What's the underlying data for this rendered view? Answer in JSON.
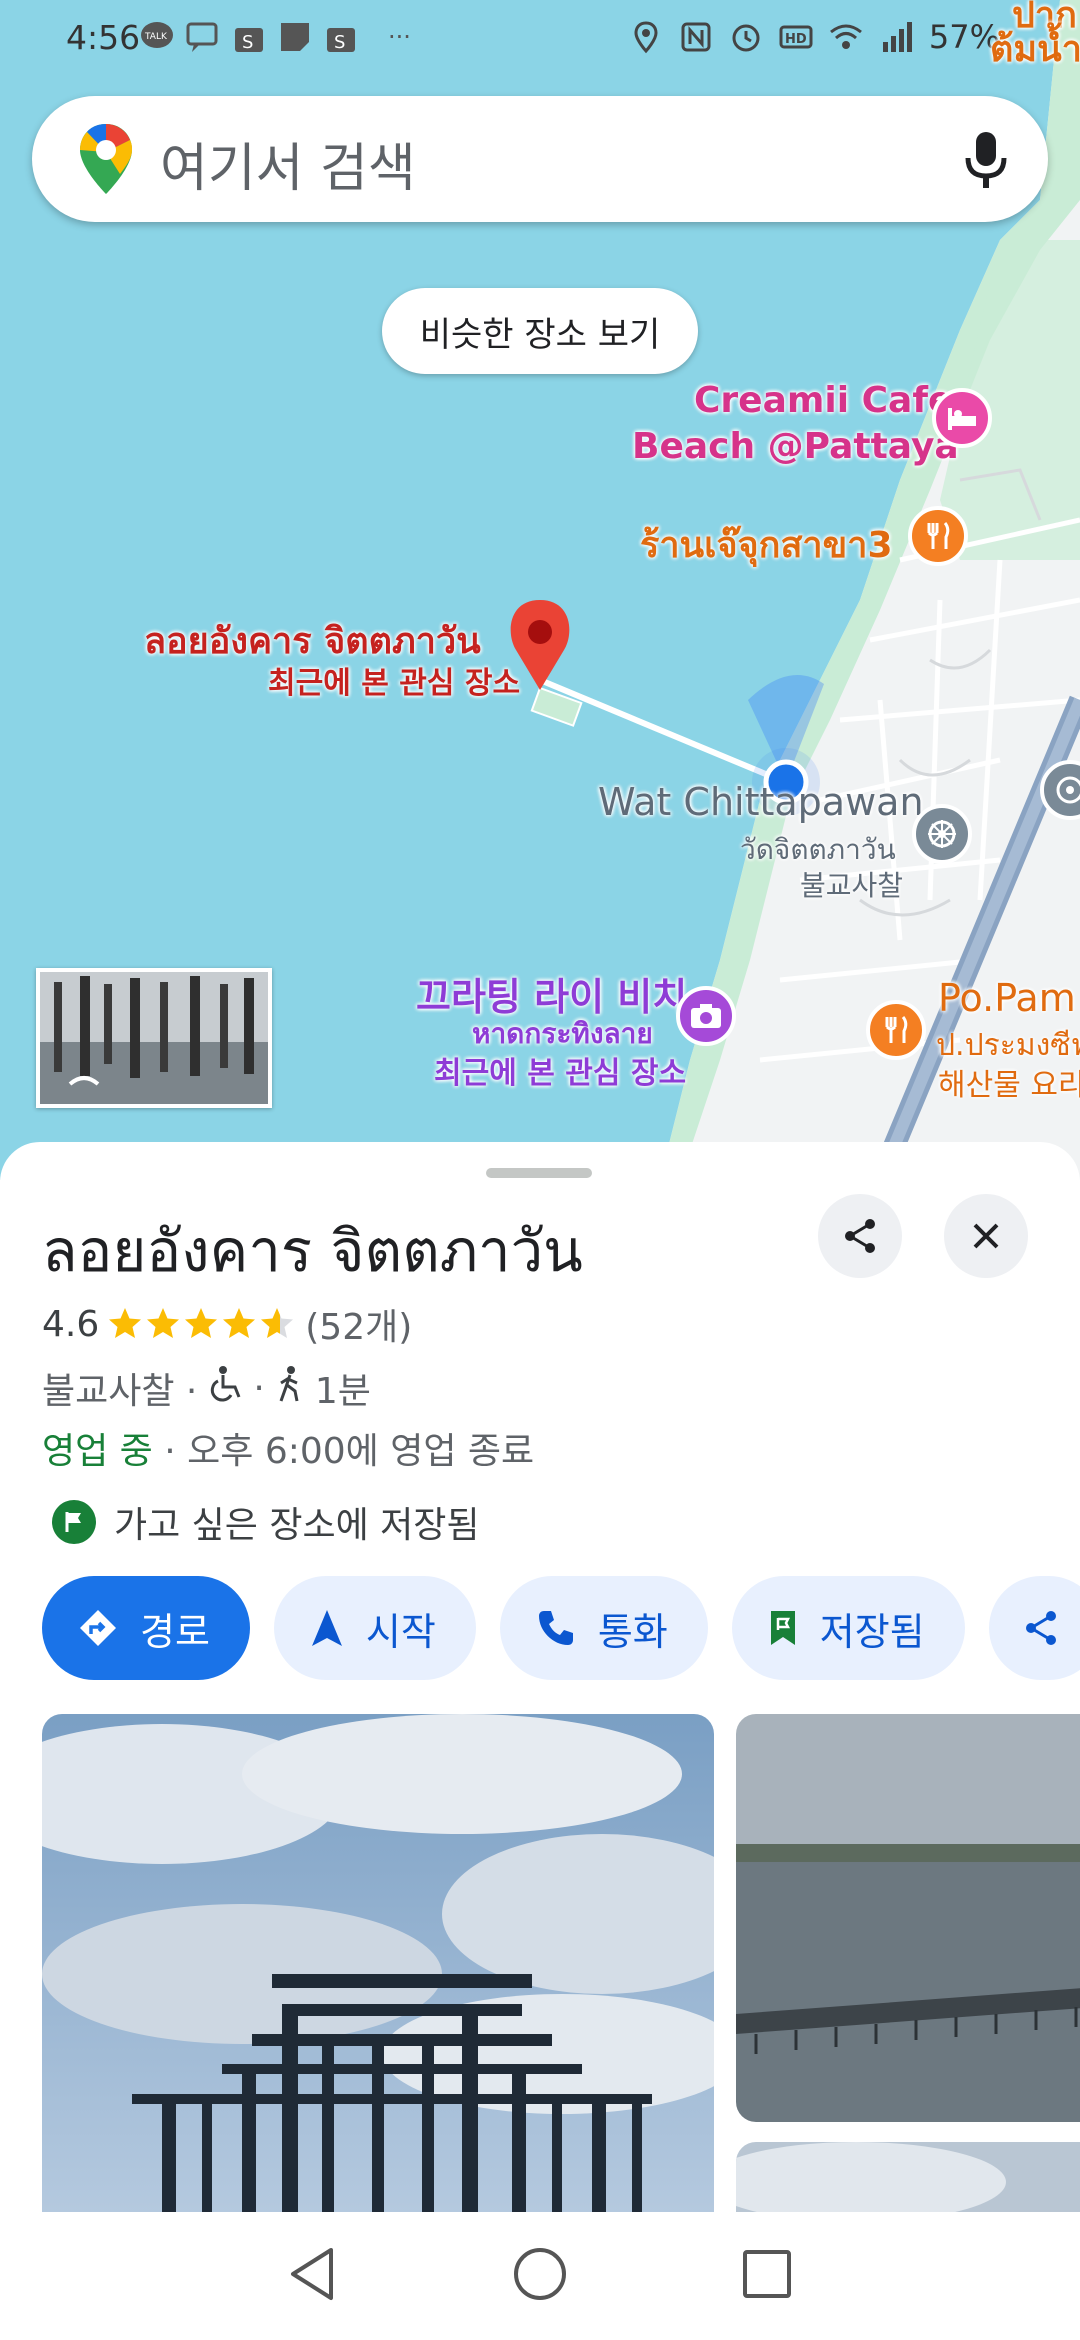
{
  "status_bar": {
    "time": "4:56",
    "battery": "57%"
  },
  "search": {
    "placeholder": "여기서 검색"
  },
  "map": {
    "similar_chip": "비슷한 장소 보기",
    "labels": {
      "creamii_line1": "Creamii Cafe",
      "creamii_line2": "Beach @Pattaya",
      "ran_jae": "ร้านเจ๊จุกสาขา3",
      "selected_name": "ลอยอังคาร จิตตภาวัน",
      "selected_sub": "최근에 본 관심 장소",
      "wat_name": "Wat Chittapawan",
      "wat_thai": "วัดจิตตภาวัน",
      "wat_ko": "불교사찰",
      "kratin_ko": "끄라팅 라이 비치",
      "kratin_thai": "หาดกระทิงลาย",
      "kratin_sub": "최근에 본 관심 장소",
      "popam": "Po.Pam",
      "popam_thai": "ป.ประมงซีฟ",
      "popam_ko": "해산물 요리",
      "top_right_1": "ปาก",
      "top_right_2": "ต้มน้ำ"
    }
  },
  "place": {
    "title": "ลอยอังคาร จิตตภาวัน",
    "rating": "4.6",
    "review_count": "(52개)",
    "category": "불교사찰 ·",
    "dot": "·",
    "walk_time": "1분",
    "open_status": "영업 중",
    "hours_text": " · 오후 6:00에 영업 종료",
    "saved_text": "가고 싶은 장소에 저장됨",
    "actions": {
      "directions": "경로",
      "start": "시작",
      "call": "통화",
      "saved": "저장됨"
    }
  },
  "colors": {
    "water": "#8bd4e6",
    "land": "#f1f3f4",
    "park": "#c9ecd6",
    "accent_blue": "#1a73e8",
    "selected_red": "#c5221f",
    "open_green": "#188038"
  }
}
